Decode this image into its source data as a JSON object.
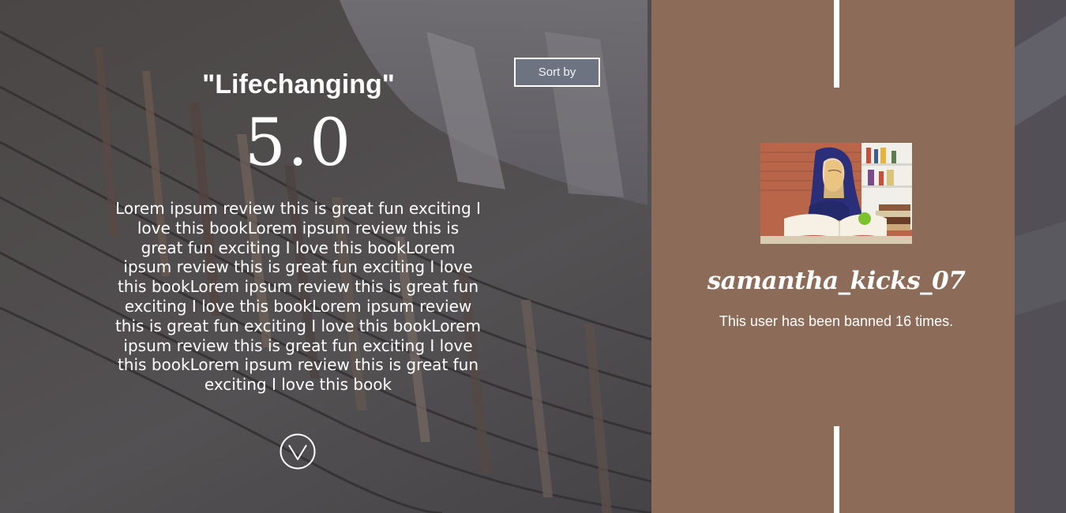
{
  "review": {
    "title": "\"Lifechanging\"",
    "score": "5.0",
    "body": "Lorem ipsum review this is great fun exciting I love this bookLorem ipsum review this is great fun exciting I love this bookLorem ipsum review this is great fun exciting I love this bookLorem ipsum review this is great fun exciting I love this bookLorem ipsum review this is great fun exciting I love this bookLorem ipsum review this is great fun exciting I love this bookLorem ipsum review this is great fun exciting I love this book"
  },
  "controls": {
    "sort_label": "Sort by",
    "expand_icon": "chevron-down-circle-icon"
  },
  "profile": {
    "username": "samantha_kicks_07",
    "ban_note": "This user has been banned 16 times.",
    "avatar_image": "girl-reading-book-photo"
  },
  "colors": {
    "panel": "#8c6b58",
    "sort_button": "#6e7382",
    "overlay": "#3e3c44",
    "text": "#ffffff"
  }
}
